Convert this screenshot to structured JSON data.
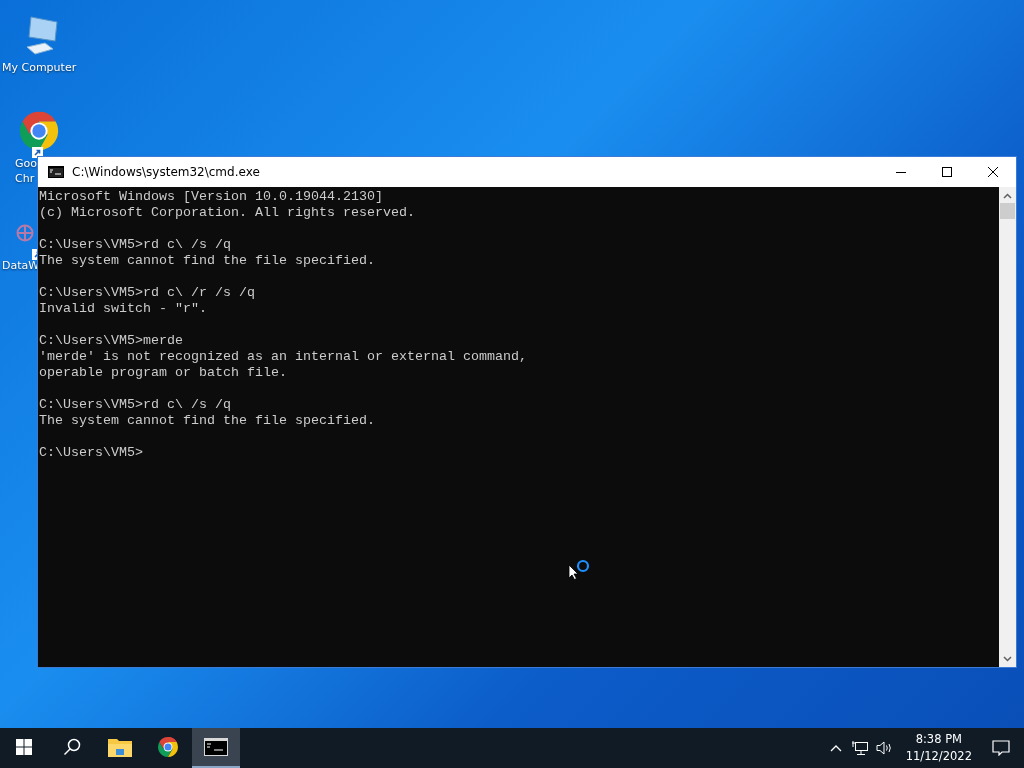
{
  "desktop_icons": [
    {
      "kind": "computer",
      "label_lines": [
        "My Computer"
      ],
      "shortcut": false
    },
    {
      "kind": "chrome",
      "label_lines": [
        "Goo",
        "Chr"
      ],
      "shortcut": true
    },
    {
      "kind": "dataw",
      "label_lines": [
        "DataW"
      ],
      "shortcut": true
    }
  ],
  "window": {
    "title": "C:\\Windows\\system32\\cmd.exe",
    "console_blocks": [
      [
        "Microsoft Windows [Version 10.0.19044.2130]",
        "(c) Microsoft Corporation. All rights reserved."
      ],
      [
        "C:\\Users\\VM5>rd c\\ /s /q",
        "The system cannot find the file specified."
      ],
      [
        "C:\\Users\\VM5>rd c\\ /r /s /q",
        "Invalid switch - \"r\"."
      ],
      [
        "C:\\Users\\VM5>merde",
        "'merde' is not recognized as an internal or external command,",
        "operable program or batch file."
      ],
      [
        "C:\\Users\\VM5>rd c\\ /s /q",
        "The system cannot find the file specified."
      ],
      [
        "C:\\Users\\VM5>"
      ]
    ]
  },
  "taskbar": {
    "apps": [
      {
        "kind": "start",
        "selected": false
      },
      {
        "kind": "search",
        "selected": false
      },
      {
        "kind": "explorer",
        "selected": false
      },
      {
        "kind": "chrome",
        "selected": false
      },
      {
        "kind": "cmd",
        "selected": true
      }
    ],
    "clock": {
      "time": "8:38 PM",
      "date": "11/12/2022"
    }
  }
}
